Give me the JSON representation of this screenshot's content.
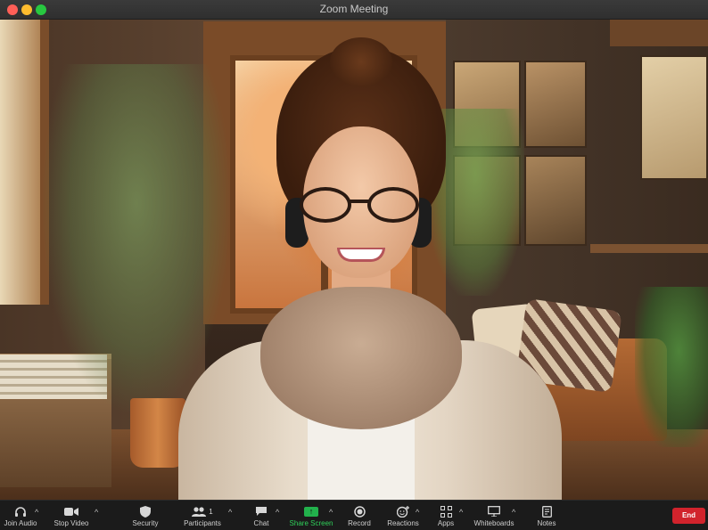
{
  "window": {
    "title": "Zoom Meeting"
  },
  "toolbar": {
    "join_audio": "Join Audio",
    "stop_video": "Stop Video",
    "security": "Security",
    "participants": "Participants",
    "participants_count": "1",
    "chat": "Chat",
    "share_screen": "Share Screen",
    "record": "Record",
    "reactions": "Reactions",
    "apps": "Apps",
    "whiteboards": "Whiteboards",
    "notes": "Notes",
    "end": "End"
  },
  "colors": {
    "share_accent": "#22b14c",
    "end_button": "#d1232c"
  },
  "icons": {
    "join_audio": "headphones-icon",
    "stop_video": "video-camera-icon",
    "security": "shield-icon",
    "participants": "people-icon",
    "chat": "chat-bubble-icon",
    "share_screen": "share-arrow-icon",
    "record": "record-icon",
    "reactions": "smiley-plus-icon",
    "apps": "apps-icon",
    "whiteboards": "whiteboard-icon",
    "notes": "notes-icon"
  }
}
